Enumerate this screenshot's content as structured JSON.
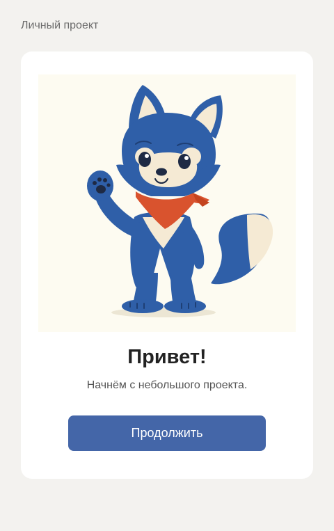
{
  "header": {
    "label": "Личный проект"
  },
  "welcome": {
    "illustration_icon": "fox-mascot-waving-icon",
    "title": "Привет!",
    "subtitle": "Начнём с небольшого проекта.",
    "continue_label": "Продолжить"
  },
  "colors": {
    "background": "#f3f2ef",
    "card": "#ffffff",
    "accent": "#4466a8",
    "fox_blue": "#2f5fa8",
    "scarf": "#d9532e"
  }
}
